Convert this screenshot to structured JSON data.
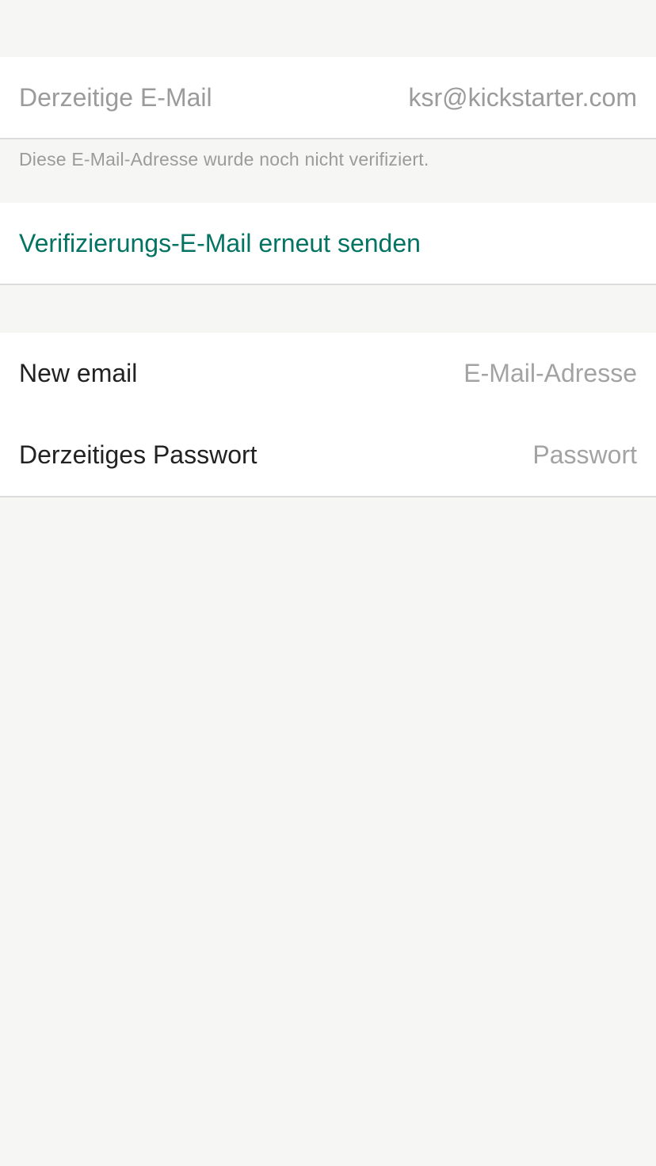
{
  "current_email": {
    "label": "Derzeitige E-Mail",
    "value": "ksr@kickstarter.com"
  },
  "verification_note": "Diese E-Mail-Adresse wurde noch nicht verifiziert.",
  "resend_link": "Verifizierungs-E-Mail erneut senden",
  "change_form": {
    "new_email_label": "New email",
    "new_email_placeholder": "E-Mail-Adresse",
    "password_label": "Derzeitiges Passwort",
    "password_placeholder": "Passwort"
  },
  "colors": {
    "accent": "#037362",
    "background": "#f6f6f4",
    "muted_text": "#9b9b9b"
  }
}
